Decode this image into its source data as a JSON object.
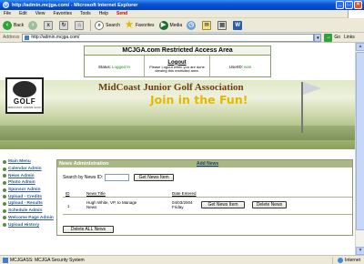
{
  "window": {
    "title": "http://admin.mcjga.com/ - Microsoft Internet Explorer"
  },
  "menubar": {
    "items": [
      "File",
      "Edit",
      "View",
      "Favorites",
      "Tools",
      "Help"
    ],
    "norton_label": "Send"
  },
  "toolbar": {
    "back_label": "Back",
    "search_label": "Search",
    "favorites_label": "Favorites",
    "media_label": "Media"
  },
  "addressbar": {
    "label": "Address",
    "url": "http://admin.mcjga.com/",
    "go_label": "Go",
    "links_label": "Links"
  },
  "access": {
    "title": "MCJGA.com Restricted Access Area",
    "status_label": "Status:",
    "status_value": "Logged In",
    "logout_label": "Logout",
    "logout_note": "Please Logout when you are done viewing this restricted area.",
    "user_label": "UserID:",
    "user_value": "ivan"
  },
  "banner": {
    "association": "MidCoast Junior Golf Association",
    "tagline": "Join in the Fun!",
    "logo_text": "GOLF",
    "logo_sub": "MIDCOAST JUNIOR GOLF"
  },
  "sidebar": {
    "items": [
      {
        "label": "Main Menu"
      },
      {
        "label": "Calendar Admin"
      },
      {
        "label": "News Admin"
      },
      {
        "label": "Photo Admin"
      },
      {
        "label": "Sponsor Admin"
      },
      {
        "label": "Upload - Credits"
      },
      {
        "label": "Upload - Results"
      },
      {
        "label": "Schedule Admin"
      },
      {
        "label": "Welcome Page Admin"
      },
      {
        "label": "Upload History"
      }
    ]
  },
  "news": {
    "panel_title": "News Administration",
    "add_link": "Add News",
    "search_label": "Search by News ID:",
    "search_value": "",
    "get_button": "Get News Item",
    "columns": {
      "id": "ID",
      "title": "News Title",
      "date": "Date Entered"
    },
    "rows": [
      {
        "id": "1",
        "title": "Hugh White, VP, to Manage News",
        "date": "04/03/2004 Friday",
        "get_label": "Get News Item",
        "delete_label": "Delete News"
      }
    ],
    "delete_all": "Delete ALL News"
  },
  "statusbar": {
    "text": "MCJGASS: MCJGA Security System",
    "zone": "Internet"
  }
}
